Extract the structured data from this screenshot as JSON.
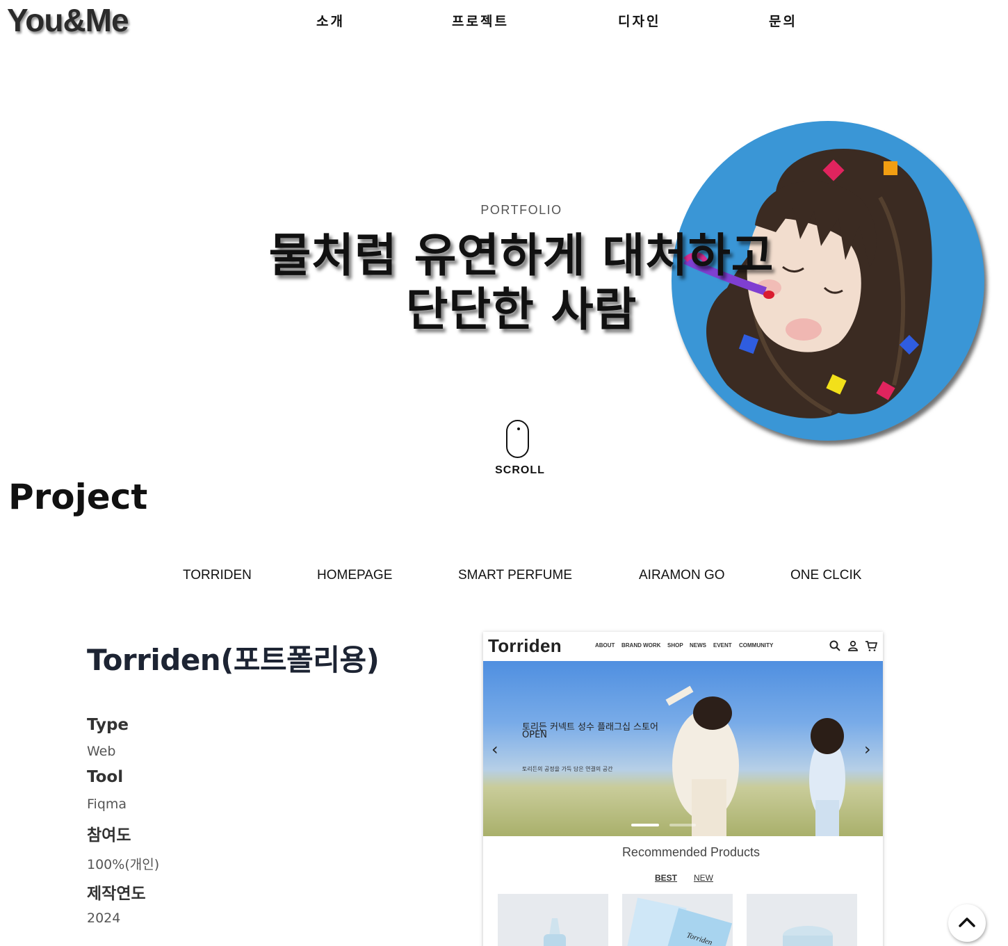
{
  "header": {
    "logo": "You&Me",
    "nav": [
      "소개",
      "프로젝트",
      "디자인",
      "문의"
    ]
  },
  "hero": {
    "label": "PORTFOLIO",
    "title_line1": "물처럼 유연하게 대처하고",
    "title_line2": "단단한 사람",
    "scroll_label": "SCROLL",
    "avatar_icon": "memoji-avatar-icon",
    "avatar_bg": "#3a96d6"
  },
  "project": {
    "section_title": "Project",
    "tabs": [
      "TORRIDEN",
      "HOMEPAGE",
      "SMART PERFUME",
      "AIRAMON GO",
      "ONE CLCIK"
    ],
    "name": "Torriden(포트폴리용)",
    "meta": {
      "type_label": "Type",
      "type_value": "Web",
      "tool_label": "Tool",
      "tool_value": "Fiqma",
      "share_label": "참여도",
      "share_value": "100%(개인)",
      "year_label": "제작연도",
      "year_value": "2024"
    },
    "preview": {
      "logo": "Torriden",
      "nav": [
        "ABOUT",
        "BRAND WORK",
        "SHOP",
        "NEWS",
        "EVENT",
        "COMMUNITY"
      ],
      "banner_title": "토리든 커넥트 성수 플래그십 스토어 OPEN",
      "banner_subtitle": "토리든의 공정을 가득 담은 연결의 공간",
      "prev_arrow": "‹",
      "next_arrow": "›",
      "recommended": "Recommended Products",
      "rec_tabs": [
        "BEST",
        "NEW"
      ],
      "product_brand": "Torriden"
    }
  },
  "scroll_top_icon": "chevron-up-icon"
}
